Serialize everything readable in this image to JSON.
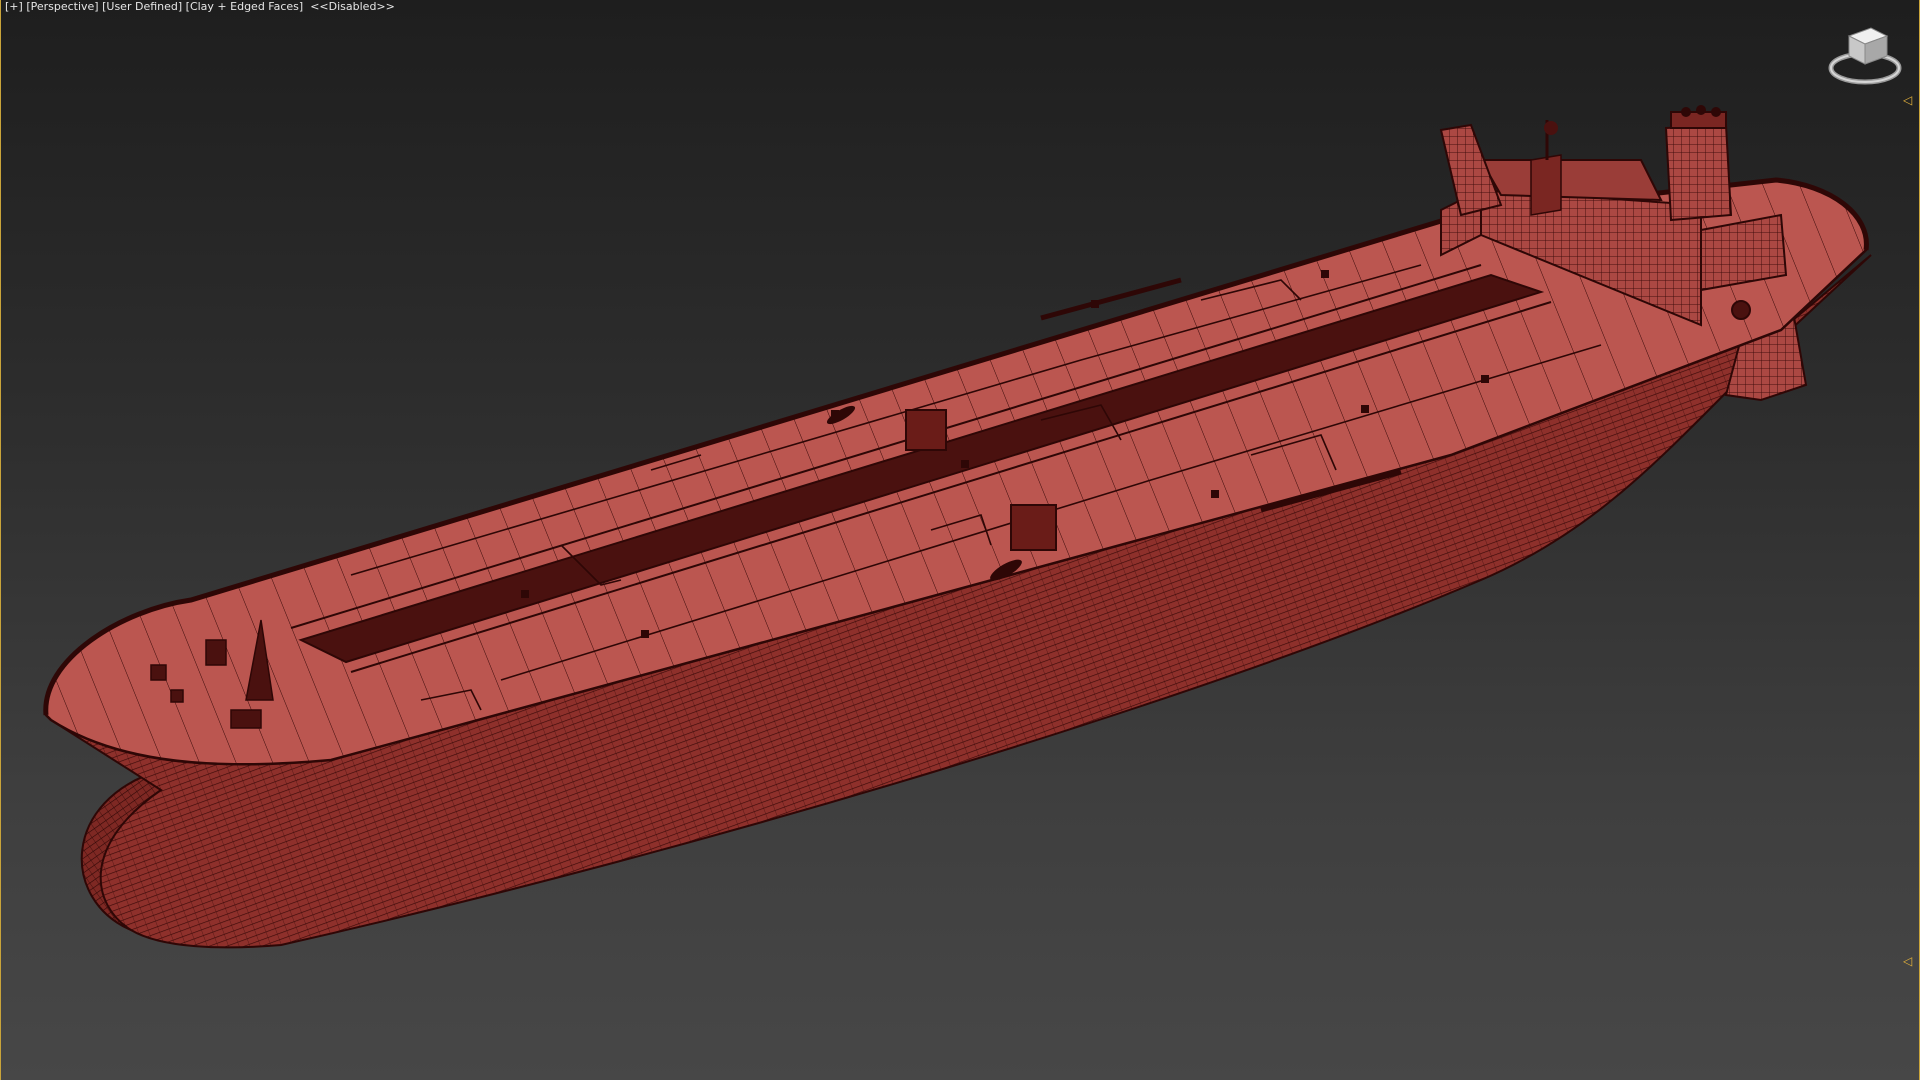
{
  "viewport": {
    "label_plus": "[+]",
    "label_view": "[Perspective]",
    "label_user": "[User Defined]",
    "label_shading": "[Clay + Edged Faces]",
    "label_disabled": "<<Disabled>>"
  },
  "scene": {
    "object": "oil-tanker-ship",
    "clay_color": "#b9514c",
    "edge_color": "#3a0a09",
    "hull_dark": "#7a2622"
  },
  "viewcube": {
    "icon": "viewcube-icon"
  },
  "markers": {
    "top": "◁",
    "bottom": "◁"
  },
  "colors": {
    "viewport_border": "#c9a43a",
    "marker": "#e3b13b"
  }
}
